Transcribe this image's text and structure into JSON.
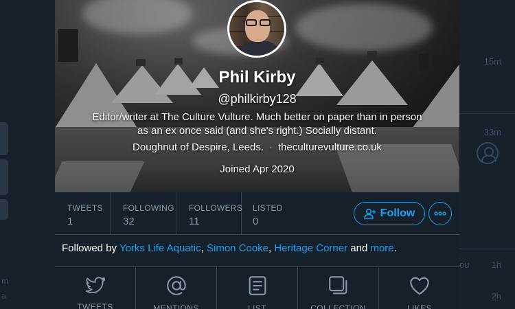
{
  "background": {
    "right_times": [
      "15m",
      "33m",
      "1h",
      "2h"
    ],
    "right_fragment": "ou",
    "left_fragments": [
      "m",
      "a"
    ]
  },
  "profile": {
    "name": "Phil Kirby",
    "handle": "@philkirby128",
    "bio": "Editor/writer at The Culture Vulture. Much better on paper than in person as an ex once said (and she's right.) Socially distant.",
    "location": "Doughnut of Despire, Leeds.",
    "separator": "·",
    "website": "theculturevulture.co.uk",
    "joined": "Joined Apr 2020"
  },
  "stats": [
    {
      "label": "TWEETS",
      "value": "1"
    },
    {
      "label": "FOLLOWING",
      "value": "32"
    },
    {
      "label": "FOLLOWERS",
      "value": "11"
    },
    {
      "label": "LISTED",
      "value": "0"
    }
  ],
  "actions": {
    "follow_label": "Follow",
    "more_icon": "more-icon"
  },
  "followed_by": {
    "prefix": "Followed by ",
    "names": [
      "Yorks Life Aquatic",
      "Simon Cooke",
      "Heritage Corner"
    ],
    "sep": ", ",
    "and": " and ",
    "more": "more",
    "end": "."
  },
  "tabs": [
    {
      "label": "TWEETS",
      "icon": "bird-icon"
    },
    {
      "label": "MENTIONS",
      "icon": "at-icon"
    },
    {
      "label": "LIST",
      "icon": "list-icon"
    },
    {
      "label": "COLLECTION",
      "icon": "collection-icon"
    },
    {
      "label": "LIKES",
      "icon": "heart-icon"
    }
  ],
  "colors": {
    "accent": "#1da1f2",
    "panel_bg": "#15202b",
    "muted": "#8899a6",
    "border": "#38444d"
  }
}
